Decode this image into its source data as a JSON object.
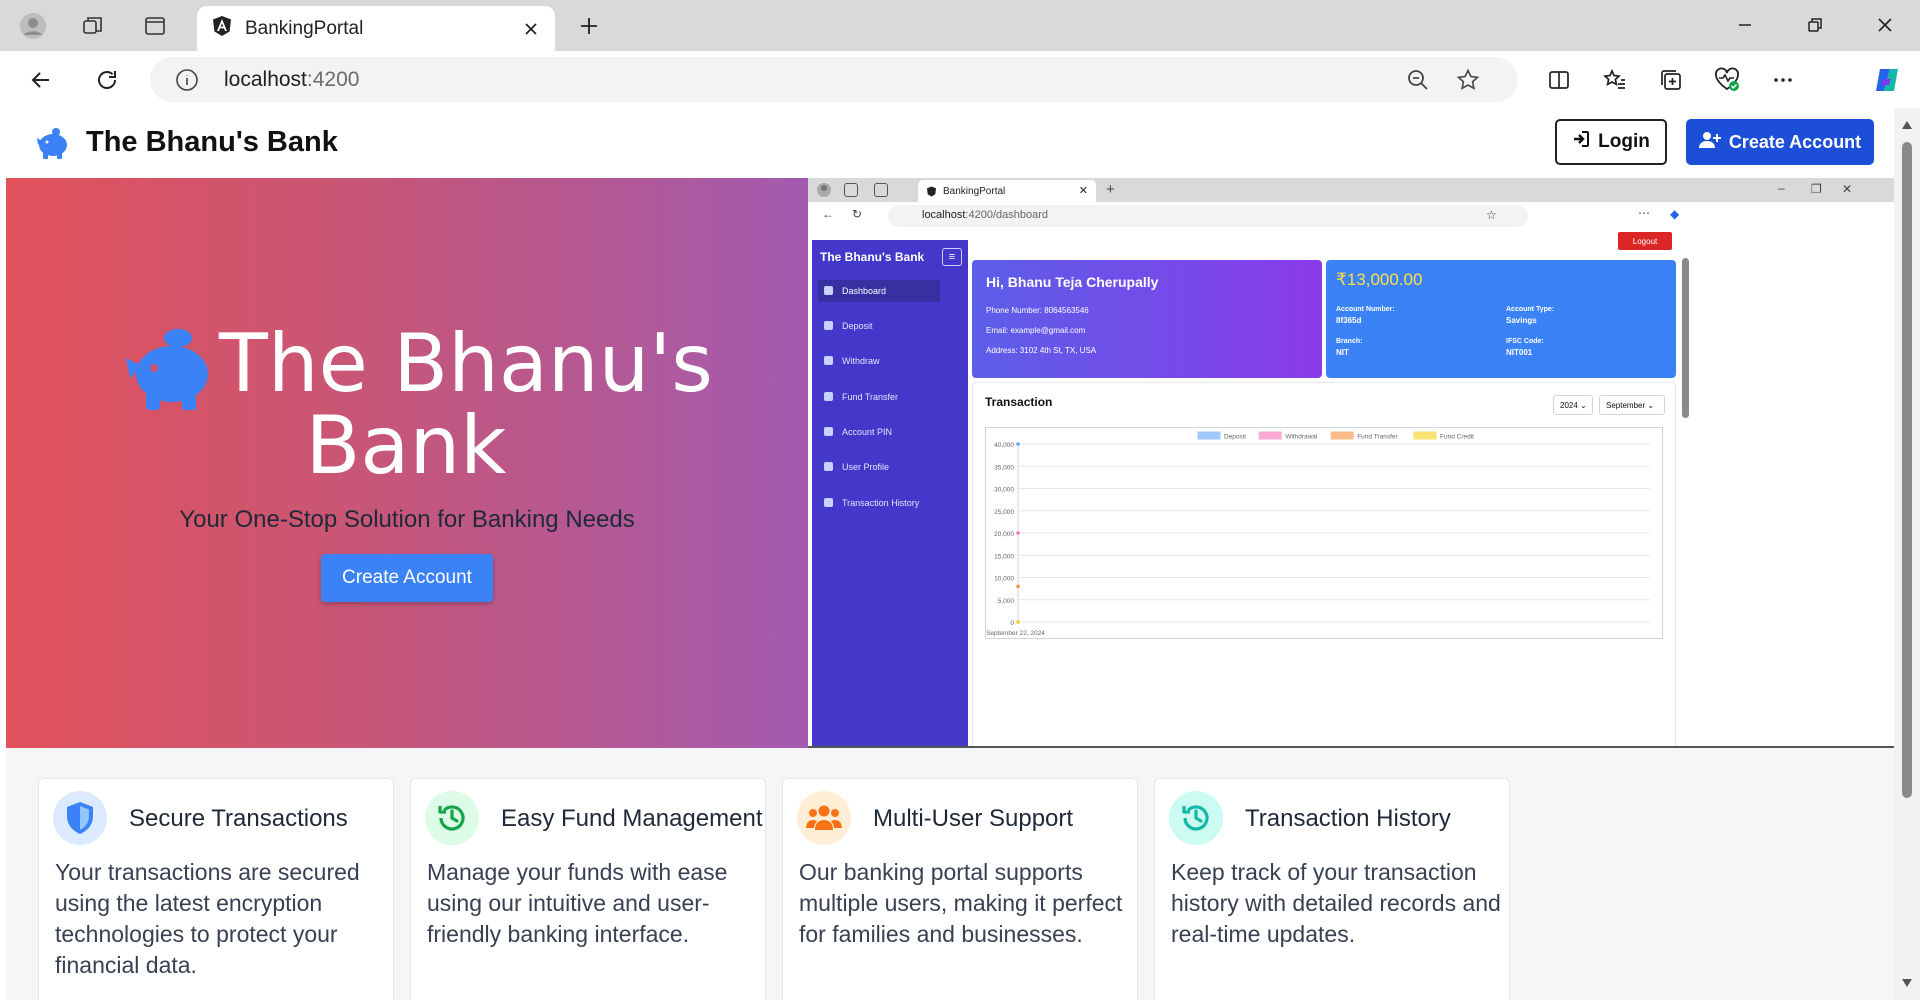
{
  "browser": {
    "tab_title": "BankingPortal",
    "url_host": "localhost",
    "url_port": ":4200"
  },
  "site": {
    "brand_name": "The Bhanu's Bank",
    "login_label": "Login",
    "create_account_label": "Create Account"
  },
  "hero": {
    "title_line1": "The Bhanu's",
    "title_line2": "Bank",
    "subtitle": "Your One-Stop Solution for Banking Needs",
    "cta_label": "Create Account"
  },
  "preview": {
    "tab_title": "BankingPortal",
    "url_host": "localhost",
    "url_path": ":4200/dashboard",
    "brand": "The Bhanu's Bank",
    "menu": [
      "Dashboard",
      "Deposit",
      "Withdraw",
      "Fund Transfer",
      "Account PIN",
      "User Profile",
      "Transaction History"
    ],
    "logout_label": "Logout",
    "greeting": "Hi, Bhanu Teja Cherupally",
    "phone": "Phone Number:  8064563546",
    "email": "Email:  example@gmail.com",
    "address": "Address:  3102 4th St, TX, USA",
    "balance": "₹13,000.00",
    "account_number_label": "Account Number:",
    "account_number": "8f365d",
    "account_type_label": "Account Type:",
    "account_type": "Savings",
    "branch_label": "Branch:",
    "branch": "NIT",
    "ifsc_label": "IFSC Code:",
    "ifsc": "NIT001",
    "transaction_title": "Transaction",
    "year": "2024",
    "month": "September",
    "x_label": "September 22, 2024"
  },
  "chart_data": {
    "type": "line",
    "categories": [
      "September 22, 2024"
    ],
    "series": [
      {
        "name": "Deposit",
        "values": [
          40000
        ],
        "color": "#60a5fa"
      },
      {
        "name": "Withdrawal",
        "values": [
          20000
        ],
        "color": "#f472b6"
      },
      {
        "name": "Fund Transfer",
        "values": [
          8000
        ],
        "color": "#fb923c"
      },
      {
        "name": "Fund Credit",
        "values": [
          0
        ],
        "color": "#facc15"
      }
    ],
    "yticks": [
      "0",
      "5,000",
      "10,000",
      "15,000",
      "20,000",
      "25,000",
      "30,000",
      "35,000",
      "40,000"
    ],
    "ylim": [
      0,
      40000
    ],
    "legend_position": "top",
    "grid": true
  },
  "features": [
    {
      "title": "Secure Transactions",
      "text": "Your transactions are secured using the latest encryption technologies to protect your financial data.",
      "icon": "shield-icon",
      "color": "#3b82f6"
    },
    {
      "title": "Easy Fund Management",
      "text": "Manage your funds with ease using our intuitive and user-friendly banking interface.",
      "icon": "history-icon",
      "color": "#16a34a"
    },
    {
      "title": "Multi-User Support",
      "text": "Our banking portal supports multiple users, making it perfect for families and businesses.",
      "icon": "users-icon",
      "color": "#f97316"
    },
    {
      "title": "Transaction History",
      "text": "Keep track of your transaction history with detailed records and real-time updates.",
      "icon": "history-icon",
      "color": "#14b8a6"
    }
  ],
  "colors": {
    "brand_blue": "#1d4ed8",
    "hero_gradient_start": "#e2525b",
    "hero_gradient_end": "#a35bb0",
    "sidebar": "#4338ca"
  }
}
